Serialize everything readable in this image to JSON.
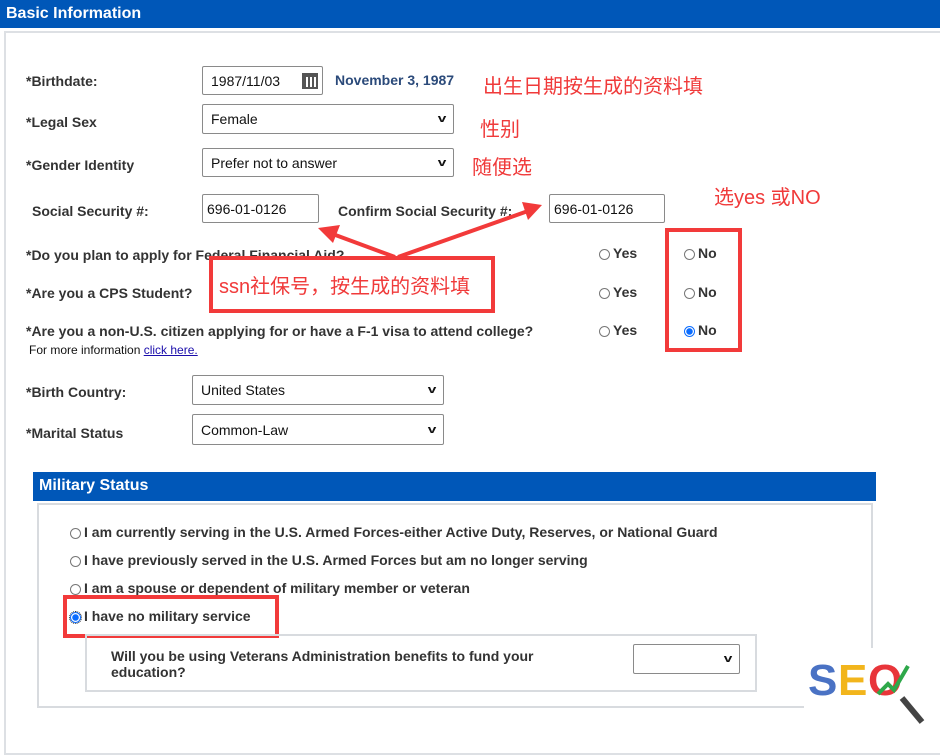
{
  "basic": {
    "title": "Basic Information",
    "birthdate_label": "*Birthdate:",
    "birthdate_value": "1987/11/03",
    "birthdate_display": "November 3, 1987",
    "legal_sex_label": "*Legal Sex",
    "legal_sex_value": "Female",
    "gender_label": "*Gender Identity",
    "gender_value": "Prefer not to answer",
    "ssn_label": "Social Security #:",
    "ssn_value": "696-01-0126",
    "confirm_ssn_label": "Confirm Social Security #:",
    "confirm_ssn_value": "696-01-0126",
    "questions": [
      {
        "text": "*Do you plan to apply for Federal Financial Aid?",
        "yes": "Yes",
        "no": "No",
        "selected": null
      },
      {
        "text": "*Are you a CPS Student?",
        "yes": "Yes",
        "no": "No",
        "selected": null
      },
      {
        "text": "*Are you a non-U.S. citizen applying for or have a F-1 visa to attend college?",
        "yes": "Yes",
        "no": "No",
        "selected": "No"
      }
    ],
    "more_info": "For more information ",
    "more_info_link": "click here.",
    "birth_country_label": "*Birth Country:",
    "birth_country_value": "United States",
    "marital_label": "*Marital Status",
    "marital_value": "Common-Law"
  },
  "annotations": {
    "birthdate": "出生日期按生成的资料填",
    "sex": "性别",
    "gender": "随便选",
    "ssn": "ssn社保号，按生成的资料填",
    "yesno": "选yes 或NO",
    "color": "#f23a3a"
  },
  "military": {
    "title": "Military Status",
    "options": [
      "I am currently serving in the U.S. Armed Forces-either Active Duty, Reserves, or National Guard",
      "I have previously served in the U.S. Armed Forces but am no longer serving",
      "I am a spouse or dependent of military member or veteran",
      "I have no military service"
    ],
    "selected_index": 3,
    "va_question": "Will you be using Veterans Administration benefits to fund your education?",
    "va_value": ""
  },
  "logo": {
    "text": "SEO"
  },
  "colors": {
    "header": "#0057b8",
    "link": "#1a0dab"
  }
}
